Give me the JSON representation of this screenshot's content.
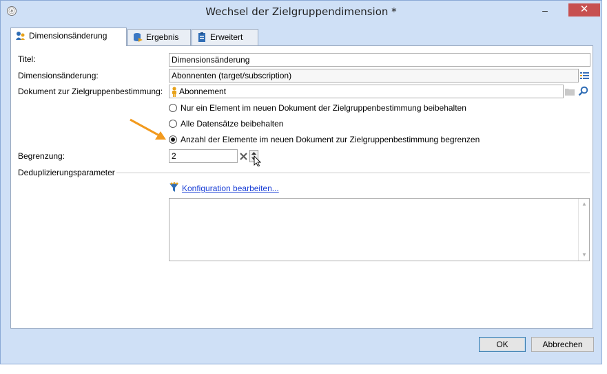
{
  "window": {
    "title": "Wechsel der Zielgruppendimension *",
    "app_icon": "app-icon",
    "minimize": "–",
    "close": "✕"
  },
  "tabs": [
    {
      "label": "Dimensionsänderung",
      "icon": "dimension-change-icon",
      "active": true
    },
    {
      "label": "Ergebnis",
      "icon": "database-icon",
      "active": false
    },
    {
      "label": "Erweitert",
      "icon": "clipboard-icon",
      "active": false
    }
  ],
  "form": {
    "title_label": "Titel:",
    "title_value": "Dimensionsänderung",
    "dimension_label": "Dimensionsänderung:",
    "dimension_value": "Abonnenten (target/subscription)",
    "document_label": "Dokument zur Zielgruppenbestimmung:",
    "document_value": "Abonnement",
    "radio_options": [
      {
        "label": "Nur ein Element im neuen Dokument der Zielgruppenbestimmung beibehalten",
        "checked": false
      },
      {
        "label": "Alle Datensätze beibehalten",
        "checked": false
      },
      {
        "label": "Anzahl der Elemente im neuen Dokument zur Zielgruppenbestimmung begrenzen",
        "checked": true
      }
    ],
    "limit_label": "Begrenzung:",
    "limit_value": "2",
    "dedup_label": "Deduplizierungsparameter",
    "config_link": "Konfiguration bearbeiten..."
  },
  "buttons": {
    "ok": "OK",
    "cancel": "Abbrechen"
  },
  "colors": {
    "window_frame": "#cfe0f6",
    "close_button": "#c75050",
    "arrow_annotation": "#f29a1e",
    "link": "#1a3fd6"
  }
}
